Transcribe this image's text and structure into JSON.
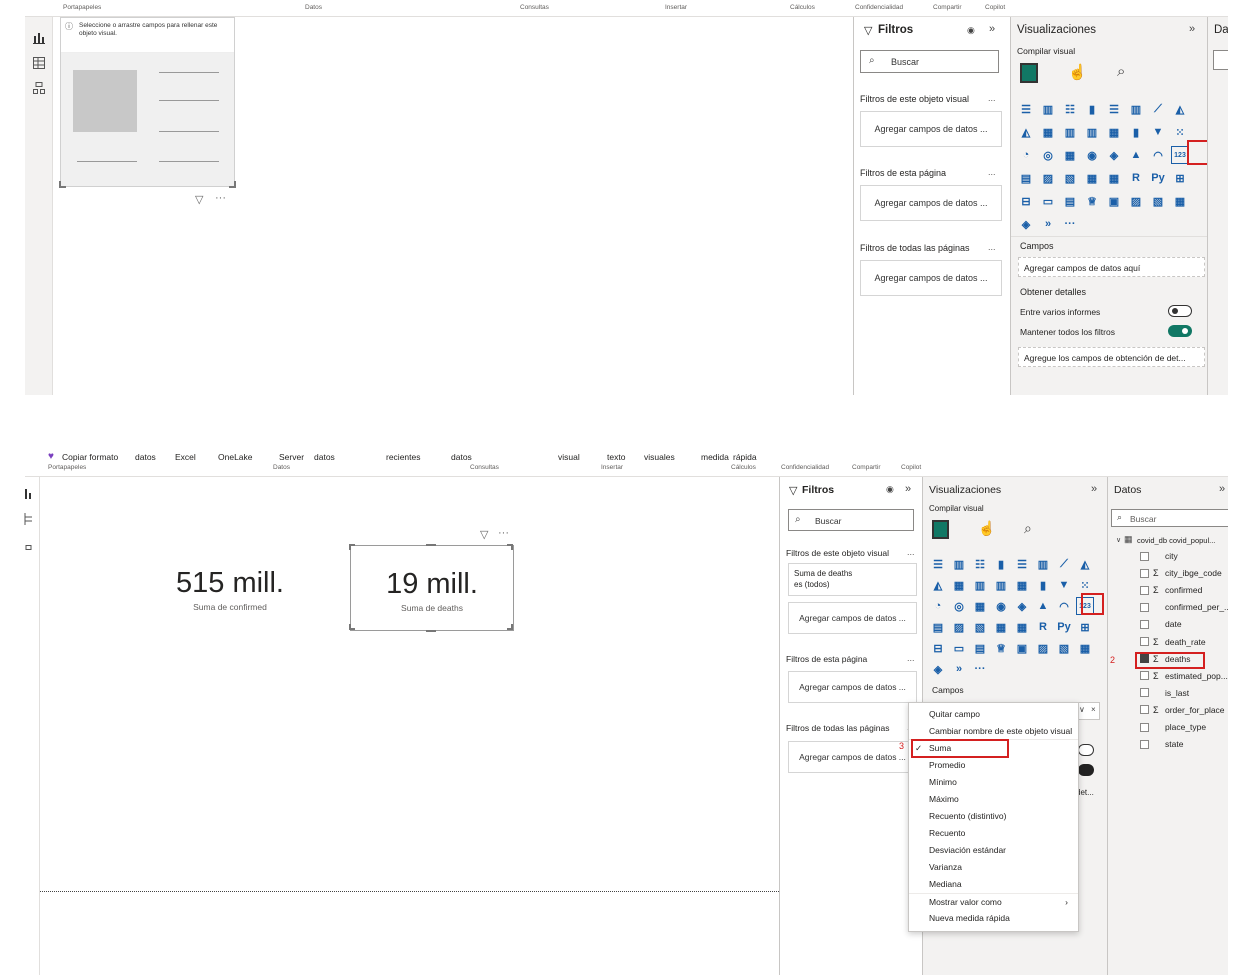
{
  "top": {
    "empty_hint": "Seleccione o arrastre campos para rellenar este objeto visual.",
    "filters": {
      "title": "Filtros",
      "search": "Buscar",
      "visual_section": "Filtros de este objeto visual",
      "page_section": "Filtros de esta página",
      "all_section": "Filtros de todas las páginas",
      "add": "Agregar campos de datos ...",
      "more": "..."
    },
    "viz": {
      "title": "Visualizaciones",
      "build": "Compilar visual",
      "fields": "Campos",
      "fields_add": "Agregar campos de datos aquí",
      "drill": "Obtener detalles",
      "cross": "Entre varios informes",
      "keep": "Mantener todos los filtros",
      "drill_add": "Agregue los campos de obtención de det..."
    },
    "data_tab": "Da",
    "ribbon": [
      "Portapapeles",
      "Datos",
      "Consultas",
      "Insertar",
      "Cálculos",
      "Confidencialidad",
      "Compartir",
      "Copilot"
    ]
  },
  "bottom": {
    "ribbon_items": [
      "Copiar formato",
      "datos",
      "Excel",
      "OneLake",
      "Server",
      "datos",
      "recientes",
      "datos",
      "visual",
      "texto",
      "visuales",
      "medida",
      "rápida"
    ],
    "ribbon_groups": [
      "Portapapeles",
      "Datos",
      "Consultas",
      "Insertar",
      "Cálculos",
      "Confidencialidad",
      "Compartir",
      "Copilot"
    ],
    "card1": {
      "value": "515 mill.",
      "label": "Suma de confirmed"
    },
    "card2": {
      "value": "19 mill.",
      "label": "Suma de deaths"
    },
    "filters": {
      "title": "Filtros",
      "search": "Buscar",
      "visual_section": "Filtros de este objeto visual",
      "visual_filter_line1": "Suma de deaths",
      "visual_filter_line2": "es (todos)",
      "page_section": "Filtros de esta página",
      "all_section": "Filtros de todas las páginas",
      "add": "Agregar campos de datos ...",
      "more": "..."
    },
    "viz": {
      "title": "Visualizaciones",
      "build": "Compilar visual",
      "fields": "Campos",
      "drill_add": "det..."
    },
    "data": {
      "title": "Datos",
      "search": "Buscar",
      "table": "covid_db covid_popul...",
      "fields": [
        {
          "name": "city",
          "sigma": false,
          "checked": false
        },
        {
          "name": "city_ibge_code",
          "sigma": true,
          "checked": false
        },
        {
          "name": "confirmed",
          "sigma": true,
          "checked": false
        },
        {
          "name": "confirmed_per_...",
          "sigma": false,
          "checked": false
        },
        {
          "name": "date",
          "sigma": false,
          "checked": false
        },
        {
          "name": "death_rate",
          "sigma": true,
          "checked": false
        },
        {
          "name": "deaths",
          "sigma": true,
          "checked": true
        },
        {
          "name": "estimated_pop...",
          "sigma": true,
          "checked": false
        },
        {
          "name": "is_last",
          "sigma": false,
          "checked": false
        },
        {
          "name": "order_for_place",
          "sigma": true,
          "checked": false
        },
        {
          "name": "place_type",
          "sigma": false,
          "checked": false
        },
        {
          "name": "state",
          "sigma": false,
          "checked": false
        }
      ]
    },
    "menu": [
      "Quitar campo",
      "Cambiar nombre de este objeto visual",
      "Suma",
      "Promedio",
      "Mínimo",
      "Máximo",
      "Recuento (distintivo)",
      "Recuento",
      "Desviación estándar",
      "Varianza",
      "Mediana",
      "Mostrar valor como",
      "Nueva medida rápida"
    ],
    "steps": [
      "1",
      "2",
      "3"
    ]
  },
  "colors": {
    "accent": "#117865",
    "red": "#d42020",
    "panel": "#f3f2f1"
  }
}
